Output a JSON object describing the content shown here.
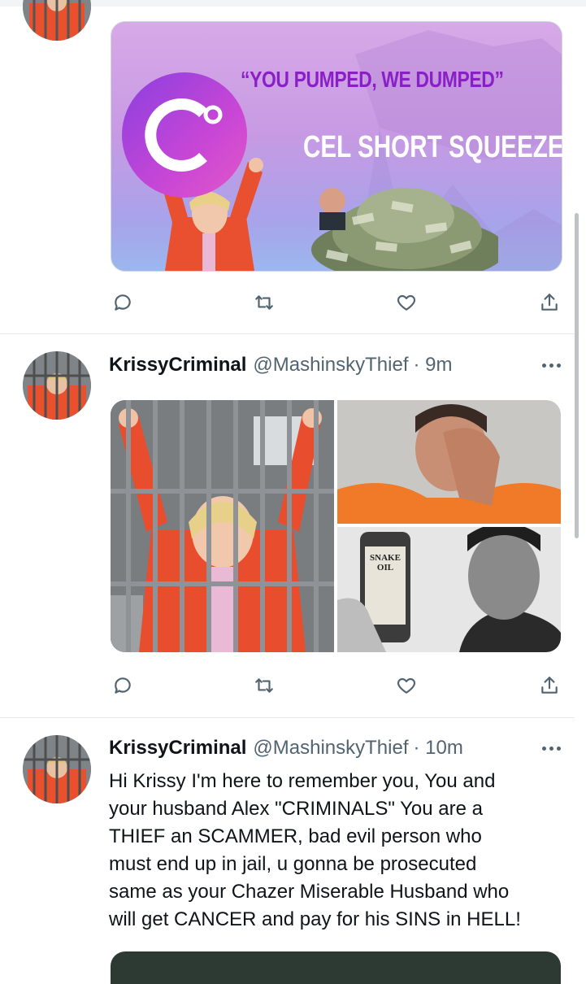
{
  "tweets": [
    {
      "media_banner": {
        "headline": "“YOU PUMPED, WE DUMPED”",
        "subhead": "CEL SHORT SQUEEZE"
      }
    },
    {
      "author_name": "KrissyCriminal",
      "author_handle": "@MashinskyThief",
      "time": "· 9m"
    },
    {
      "author_name": "KrissyCriminal",
      "author_handle": "@MashinskyThief",
      "time": "· 10m",
      "text": "Hi Krissy I'm here to remember you, You and\nyour husband Alex   \"CRIMINALS\" You are a\nTHIEF an SCAMMER, bad evil person who\nmust end up in jail, u gonna be prosecuted\nsame as your Chazer Miserable Husband who\nwill get CANCER and pay for his SINS in HELL!"
    }
  ],
  "media_labels": {
    "bottle_label": "SNAKE\nOIL"
  },
  "icons": [
    "reply-icon",
    "retweet-icon",
    "like-icon",
    "share-icon",
    "more-icon"
  ],
  "colors": {
    "text_primary": "#0f1419",
    "text_secondary": "#536471",
    "divider": "#e7e9ea",
    "banner_headline": "#8b1fc7"
  }
}
